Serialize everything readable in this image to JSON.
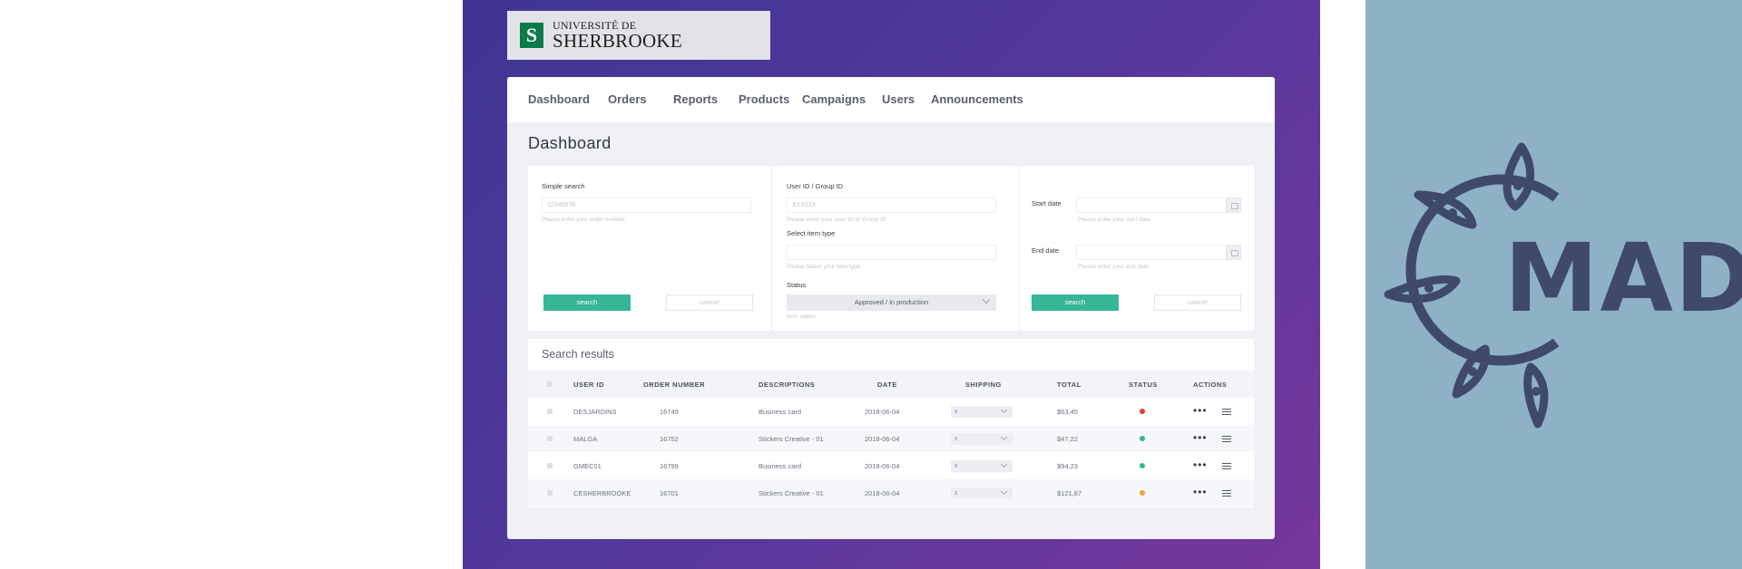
{
  "brand": {
    "logo_mark": "S",
    "line1": "UNIVERSITÉ DE",
    "line2": "SHERBROOKE"
  },
  "nav": {
    "items": [
      "Dashboard",
      "Orders",
      "Reports",
      "Products",
      "Campaigns",
      "Users",
      "Announcements"
    ]
  },
  "page": {
    "title": "Dashboard"
  },
  "filters": {
    "simple_search": {
      "label": "Simple search",
      "placeholder": "12345678",
      "hint": "Please enter your order number"
    },
    "user_id": {
      "label": "User ID / Group ID",
      "placeholder": "XXX123",
      "hint": "Please enter your user ID or Group ID"
    },
    "item_type": {
      "label": "Select item type",
      "hint": "Please select your item type"
    },
    "status": {
      "label": "Status",
      "value": "Approved / in production",
      "hint": "Item status"
    },
    "start_date": {
      "label": "Start date",
      "hint": "Please enter your start date"
    },
    "end_date": {
      "label": "End date",
      "hint": "Please enter your end date"
    },
    "search_label": "search",
    "cancel_label": "cancel"
  },
  "results": {
    "title": "Search results",
    "columns": [
      "USER ID",
      "ORDER NUMBER",
      "DESCRIPTIONS",
      "DATE",
      "SHIPPING",
      "TOTAL",
      "STATUS",
      "ACTIONS"
    ],
    "rows": [
      {
        "user_id": "DESJARDINS",
        "order": "16749",
        "description": "Business card",
        "date": "2018-06-04",
        "shipping": "x",
        "total": "$63,45",
        "status_color": "#e03b3b"
      },
      {
        "user_id": "MALGA",
        "order": "16752",
        "description": "Stickers Creative - 01",
        "date": "2018-06-04",
        "shipping": "x",
        "total": "$47,22",
        "status_color": "#36b597"
      },
      {
        "user_id": "GMEC01",
        "order": "16799",
        "description": "Business card",
        "date": "2018-06-04",
        "shipping": "x",
        "total": "$94,23",
        "status_color": "#36b597"
      },
      {
        "user_id": "CESHERBROOKE",
        "order": "16701",
        "description": "Stickers Creative - 01",
        "date": "2018-06-04",
        "shipping": "x",
        "total": "$121,87",
        "status_color": "#f0a531"
      }
    ],
    "actions_label": "•••"
  },
  "side_logo": {
    "text": "MADE"
  }
}
